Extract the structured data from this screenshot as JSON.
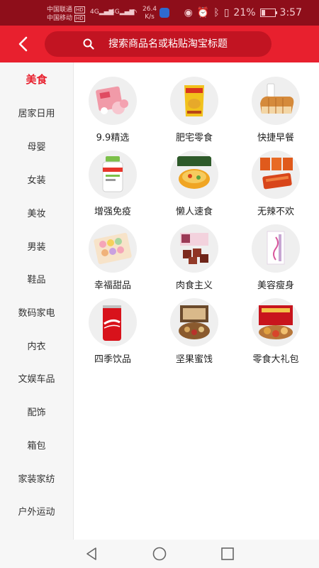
{
  "status_bar": {
    "carrier1": "中国联通",
    "carrier2": "中国移动",
    "hd": "HD",
    "net": "4G",
    "speed_value": "26.4",
    "speed_unit": "K/s",
    "battery": "21%",
    "time": "3:57"
  },
  "search": {
    "placeholder": "搜索商品名或粘贴淘宝标题"
  },
  "sidebar": {
    "items": [
      {
        "label": "美食"
      },
      {
        "label": "居家日用"
      },
      {
        "label": "母婴"
      },
      {
        "label": "女装"
      },
      {
        "label": "美妆"
      },
      {
        "label": "男装"
      },
      {
        "label": "鞋品"
      },
      {
        "label": "数码家电"
      },
      {
        "label": "内衣"
      },
      {
        "label": "文娱车品"
      },
      {
        "label": "配饰"
      },
      {
        "label": "箱包"
      },
      {
        "label": "家装家纺"
      },
      {
        "label": "户外运动"
      }
    ]
  },
  "grid": {
    "items": [
      {
        "label": "9.9精选",
        "icon": "snack-package-icon"
      },
      {
        "label": "肥宅零食",
        "icon": "chips-bag-icon"
      },
      {
        "label": "快捷早餐",
        "icon": "bread-icon"
      },
      {
        "label": "增强免疫",
        "icon": "supplement-bottle-icon"
      },
      {
        "label": "懒人速食",
        "icon": "noodle-bowl-icon"
      },
      {
        "label": "无辣不欢",
        "icon": "spicy-strips-icon"
      },
      {
        "label": "幸福甜品",
        "icon": "macaron-box-icon"
      },
      {
        "label": "肉食主义",
        "icon": "meat-cubes-icon"
      },
      {
        "label": "美容瘦身",
        "icon": "beauty-box-icon"
      },
      {
        "label": "四季饮品",
        "icon": "cola-can-icon"
      },
      {
        "label": "坚果蜜饯",
        "icon": "nuts-box-icon"
      },
      {
        "label": "零食大礼包",
        "icon": "gift-pack-icon"
      }
    ]
  },
  "colors": {
    "accent": "#e8202e",
    "status_bar": "#8e0e1a",
    "search_bg": "#c21422"
  }
}
